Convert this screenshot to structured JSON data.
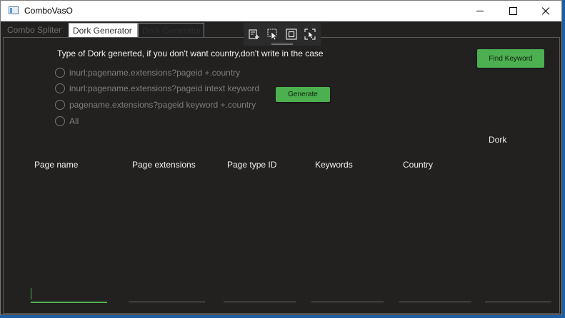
{
  "window": {
    "title": "ComboVasO",
    "icon": "app-window-icon",
    "controls": [
      "minimize-icon",
      "maximize-icon",
      "close-icon"
    ]
  },
  "tabs": [
    {
      "label": "Combo Spliter",
      "state": "inactive"
    },
    {
      "label": "Dork Generator",
      "state": "selected"
    },
    {
      "label": "Dork Generator",
      "state": "hovered"
    }
  ],
  "debug_toolbar": {
    "icons": [
      "live-visual-tree-icon",
      "select-element-icon",
      "display-layout-adorners-icon",
      "track-focused-element-icon"
    ]
  },
  "dork_options": {
    "heading": "Type of Dork generted, if you don't want country,don't write in the case",
    "options": [
      {
        "label": "inurl:pagename.extensions?pageid +.country",
        "checked": false
      },
      {
        "label": "inurl:pagename.extensions?pageid intext keyword",
        "checked": false
      },
      {
        "label": "pagename.extensions?pageid keyword +.country",
        "checked": false
      },
      {
        "label": "All",
        "checked": false
      }
    ]
  },
  "buttons": {
    "generate": "Generate",
    "find_keyword": "Find Keyword"
  },
  "dork_label": "Dork",
  "columns": [
    {
      "label": "Page name",
      "value": ""
    },
    {
      "label": "Page extensions",
      "value": ""
    },
    {
      "label": "Page type ID",
      "value": ""
    },
    {
      "label": "Keywords",
      "value": ""
    },
    {
      "label": "Country",
      "value": ""
    },
    {
      "label": "",
      "value": ""
    }
  ],
  "colors": {
    "accent": "#4caf50",
    "background": "#222120",
    "desktop": "#1f5fa3"
  }
}
